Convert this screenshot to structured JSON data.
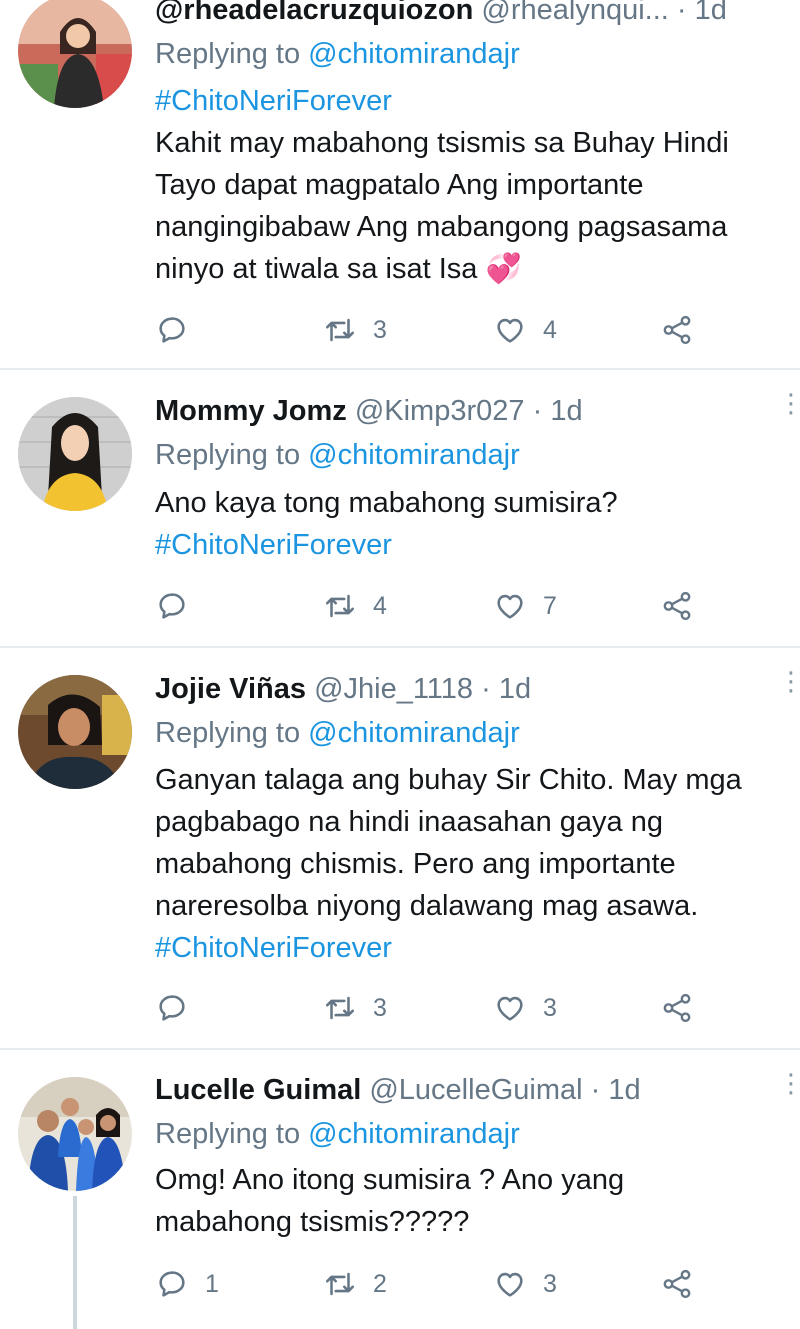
{
  "tweets": [
    {
      "name": "@rheadelacruzquiozon",
      "handle": "@rhealynqui...",
      "time": "1d",
      "replying_prefix": "Replying to ",
      "replying_to": "@chitomirandajr",
      "lines": [
        "#ChitoNeriForever",
        "Kahit may mabahong tsismis sa Buhay Hindi",
        "Tayo dapat magpatalo Ang importante",
        "nangingibabaw Ang mabangong pagsasama",
        "ninyo at tiwala sa isat Isa 💞"
      ],
      "reply_count": "",
      "retweet_count": "3",
      "like_count": "4"
    },
    {
      "name": "Mommy Jomz",
      "handle": "@Kimp3r027",
      "time": "1d",
      "replying_prefix": "Replying to ",
      "replying_to": "@chitomirandajr",
      "lines": [
        "Ano kaya tong mabahong sumisira?",
        "#ChitoNeriForever"
      ],
      "reply_count": "",
      "retweet_count": "4",
      "like_count": "7"
    },
    {
      "name": "Jojie Viñas",
      "handle": "@Jhie_1118",
      "time": "1d",
      "replying_prefix": "Replying to ",
      "replying_to": "@chitomirandajr",
      "lines": [
        "Ganyan talaga ang buhay Sir Chito. May mga",
        "pagbabago na hindi inaasahan gaya ng",
        "mabahong chismis. Pero ang importante",
        "nareresolba niyong dalawang mag asawa.",
        "#ChitoNeriForever"
      ],
      "reply_count": "",
      "retweet_count": "3",
      "like_count": "3"
    },
    {
      "name": "Lucelle Guimal",
      "handle": "@LucelleGuimal",
      "time": "1d",
      "replying_prefix": "Replying to ",
      "replying_to": "@chitomirandajr",
      "lines": [
        "Omg! Ano itong sumisira ? Ano yang",
        "mabahong tsismis?????"
      ],
      "reply_count": "1",
      "retweet_count": "2",
      "like_count": "3"
    }
  ],
  "separator": "·",
  "colors": {
    "accent": "#1b95e0",
    "secondary_text": "#657786",
    "divider": "#e6ecf0"
  },
  "icons": [
    "reply-icon",
    "retweet-icon",
    "like-icon",
    "share-icon",
    "more-options-icon"
  ]
}
